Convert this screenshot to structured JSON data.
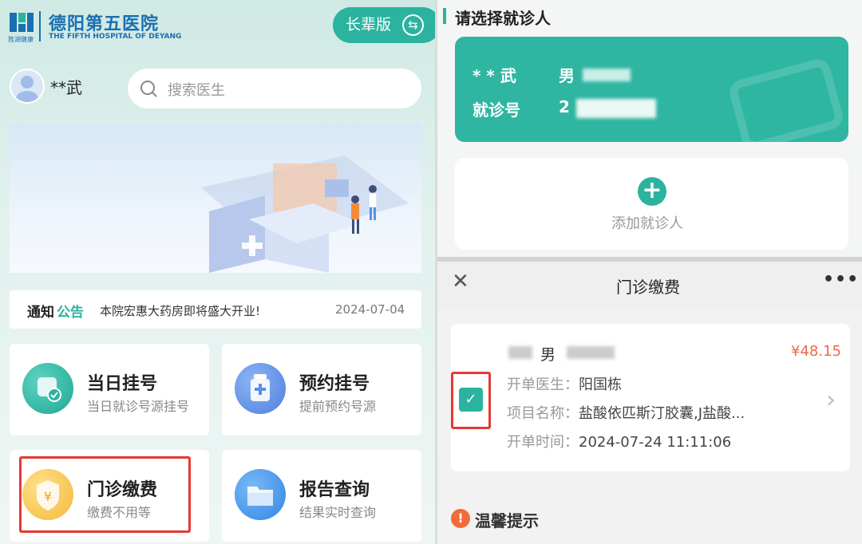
{
  "left": {
    "logo_sub": "旌湖健康",
    "hospital_name": "德阳第五医院",
    "hospital_en": "THE FIFTH HOSPITAL OF DEYANG",
    "elder_mode_label": "长辈版",
    "elder_mode_icon": "swap-icon",
    "username": "**武",
    "search_placeholder": "搜索医生",
    "notice": {
      "prefix_1": "通知",
      "prefix_2": "公告",
      "text": "本院宏惠大药房即将盛大开业!",
      "date": "2024-07-04"
    },
    "cards": [
      {
        "title": "当日挂号",
        "subtitle": "当日就诊号源挂号",
        "icon": "calendar-check-icon",
        "color": "#2bb3a0"
      },
      {
        "title": "预约挂号",
        "subtitle": "提前预约号源",
        "icon": "medicine-bottle-icon",
        "color": "#5b8fe6"
      },
      {
        "title": "门诊缴费",
        "subtitle": "缴费不用等",
        "icon": "yuan-shield-icon",
        "color": "#f3b93a"
      },
      {
        "title": "报告查询",
        "subtitle": "结果实时查询",
        "icon": "folder-icon",
        "color": "#3d8fe8"
      }
    ]
  },
  "right_top": {
    "section_title": "请选择就诊人",
    "patient": {
      "name": "* * 武",
      "gender": "男",
      "id_label": "就诊号",
      "id_value": "2"
    },
    "add_label": "添加就诊人"
  },
  "right_bottom": {
    "header_title": "门诊缴费",
    "close_icon": "close-icon",
    "more_icon": "more-icon",
    "bill": {
      "patient_gender": "男",
      "price": "¥48.15",
      "doctor_label": "开单医生：",
      "doctor_value": "阳国栋",
      "item_label": "项目名称：",
      "item_value": "盐酸依匹斯汀胶囊,J盐酸...",
      "time_label": "开单时间：",
      "time_value": "2024-07-24 11:11:06"
    },
    "tip_title": "温馨提示"
  }
}
